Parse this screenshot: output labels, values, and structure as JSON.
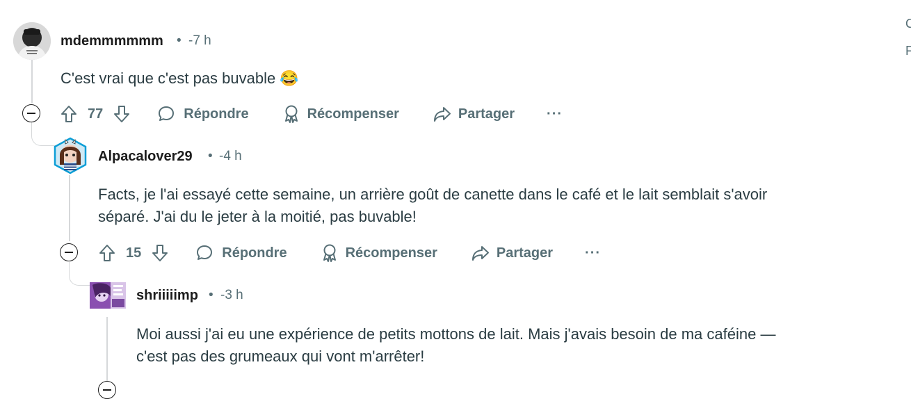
{
  "comments": [
    {
      "username": "mdemmmmmm",
      "separator": "•",
      "time": "-7 h",
      "body_lines": [
        "C'est vrai que c'est pas buvable 😂"
      ],
      "upvotes": "77",
      "reply_label": "Répondre",
      "award_label": "Récompenser",
      "share_label": "Partager",
      "more_label": "···"
    },
    {
      "username": "Alpacalover29",
      "separator": "•",
      "time": "-4 h",
      "body_lines": [
        "Facts, je l'ai essayé cette semaine, un arrière goût de canette dans le café et le lait semblait s'avoir",
        "séparé. J'ai du le jeter à la moitié, pas buvable!"
      ],
      "upvotes": "15",
      "reply_label": "Répondre",
      "award_label": "Récompenser",
      "share_label": "Partager",
      "more_label": "···"
    },
    {
      "username": "shriiiiimp",
      "separator": "•",
      "time": "-3 h",
      "body_lines": [
        "Moi aussi j'ai eu une expérience de petits mottons de lait. Mais j'avais besoin de ma caféine —",
        "c'est pas des grumeaux qui vont m'arrêter!"
      ]
    }
  ],
  "edge_chars": [
    "C",
    "F"
  ],
  "colors": {
    "meta": "#576f76",
    "thread": "#d6d8da",
    "text": "#2a3c42"
  }
}
